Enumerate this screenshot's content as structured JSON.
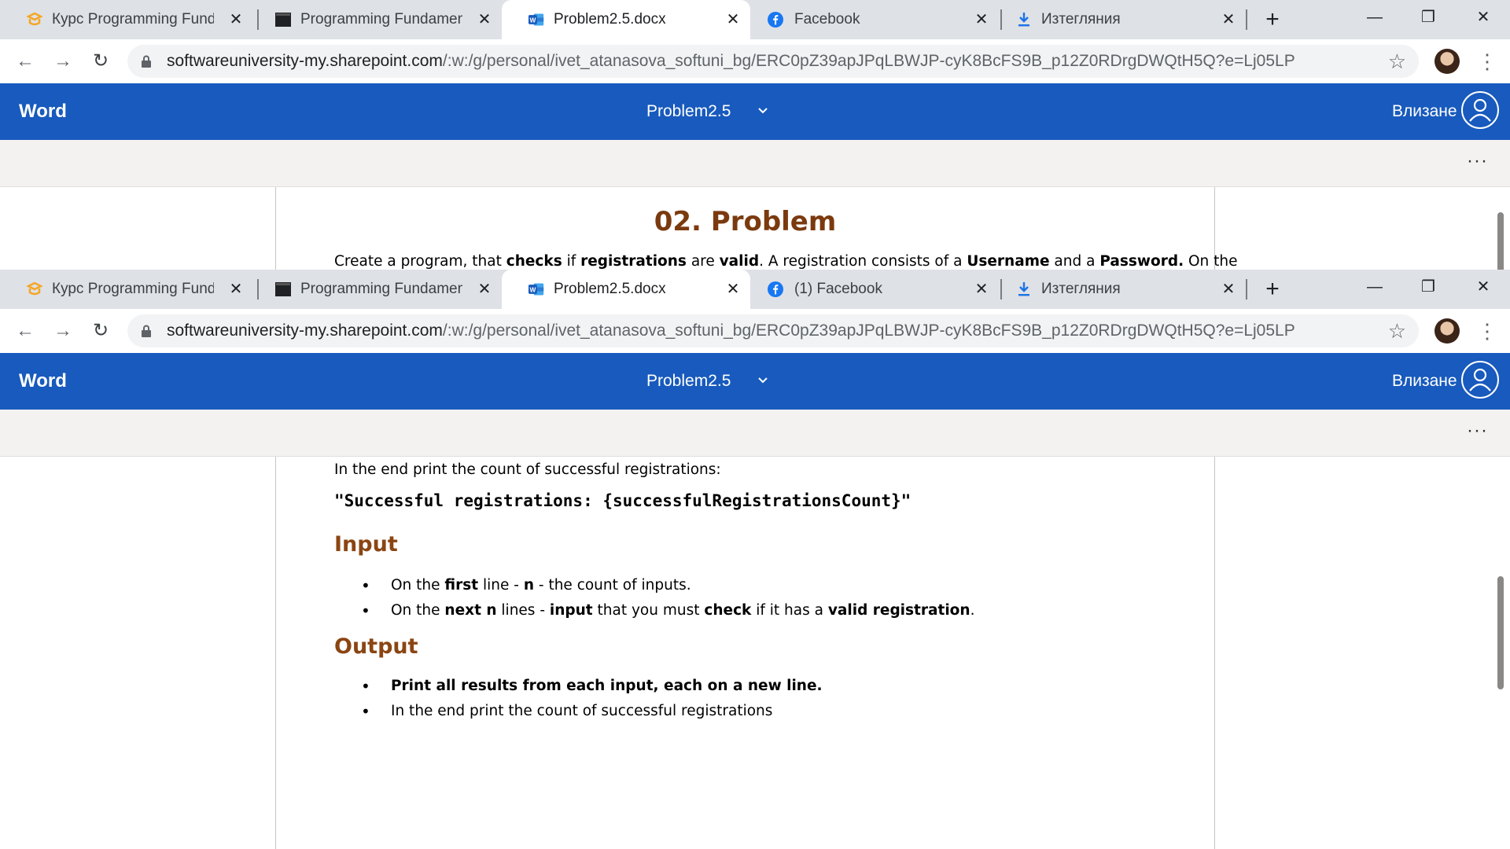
{
  "colors": {
    "word_blue": "#185abd",
    "heading_brown": "#7b3a0e",
    "tabstrip": "#dee1e6"
  },
  "window1": {
    "tabs": [
      {
        "icon": "softuni-logo-icon",
        "title": "Курс Programming Fundam",
        "active": false
      },
      {
        "icon": "terminal-icon",
        "title": "Programming Fundamental",
        "active": false
      },
      {
        "icon": "word-icon",
        "title": "Problem2.5.docx",
        "active": true
      },
      {
        "icon": "facebook-icon",
        "title": "Facebook",
        "active": false
      },
      {
        "icon": "download-icon",
        "title": "Изтегляния",
        "active": false
      }
    ],
    "url_host": "softwareuniversity-my.sharepoint.com",
    "url_path": "/:w:/g/personal/ivet_atanasova_softuni_bg/ERC0pZ39apJPqLBWJP-cyK8BcFS9B_p12Z0RDrgDWQtH5Q?e=Lj05LP",
    "app_name": "Word",
    "doc_title": "Problem2.5",
    "signin_label": "Влизане",
    "ribbon_more": "···",
    "content": {
      "heading": "02. Problem",
      "intro": {
        "t1": "Create a program, that ",
        "b1": "checks",
        "t2": " if ",
        "b2": "registrations",
        "t3": " are ",
        "b3": "valid",
        "t4": ". A registration consists of a ",
        "b4": "Username",
        "t5": " and a ",
        "b5": "Password.",
        "t6": " On the"
      }
    }
  },
  "window2": {
    "tabs": [
      {
        "icon": "softuni-logo-icon",
        "title": "Курс Programming Fundam",
        "active": false
      },
      {
        "icon": "terminal-icon",
        "title": "Programming Fundamental",
        "active": false
      },
      {
        "icon": "word-icon",
        "title": "Problem2.5.docx",
        "active": true
      },
      {
        "icon": "facebook-icon",
        "title": "(1) Facebook",
        "active": false
      },
      {
        "icon": "download-icon",
        "title": "Изтегляния",
        "active": false
      }
    ],
    "url_host": "softwareuniversity-my.sharepoint.com",
    "url_path": "/:w:/g/personal/ivet_atanasova_softuni_bg/ERC0pZ39apJPqLBWJP-cyK8BcFS9B_p12Z0RDrgDWQtH5Q?e=Lj05LP",
    "app_name": "Word",
    "doc_title": "Problem2.5",
    "signin_label": "Влизане",
    "ribbon_more": "···",
    "content": {
      "end_line": "In the end print the count of successful registrations:",
      "code_line": "\"Successful registrations: {successfulRegistrationsCount}\"",
      "input_heading": "Input",
      "input_items": [
        {
          "t1": "On the ",
          "b1": "first",
          "t2": " line - ",
          "b2": "n",
          "t3": " - the count of inputs."
        },
        {
          "t1": "On the ",
          "b1": "next n",
          "t2": " lines - ",
          "b2": "input",
          "t3": " that you must ",
          "b3": "check",
          "t4": " if it has a ",
          "b4": "valid registration",
          "t5": "."
        }
      ],
      "output_heading": "Output",
      "output_items": [
        {
          "b1": "Print all results from each input, each on a new line."
        },
        {
          "t1": "In the end print the count of successful registrations"
        }
      ]
    }
  }
}
